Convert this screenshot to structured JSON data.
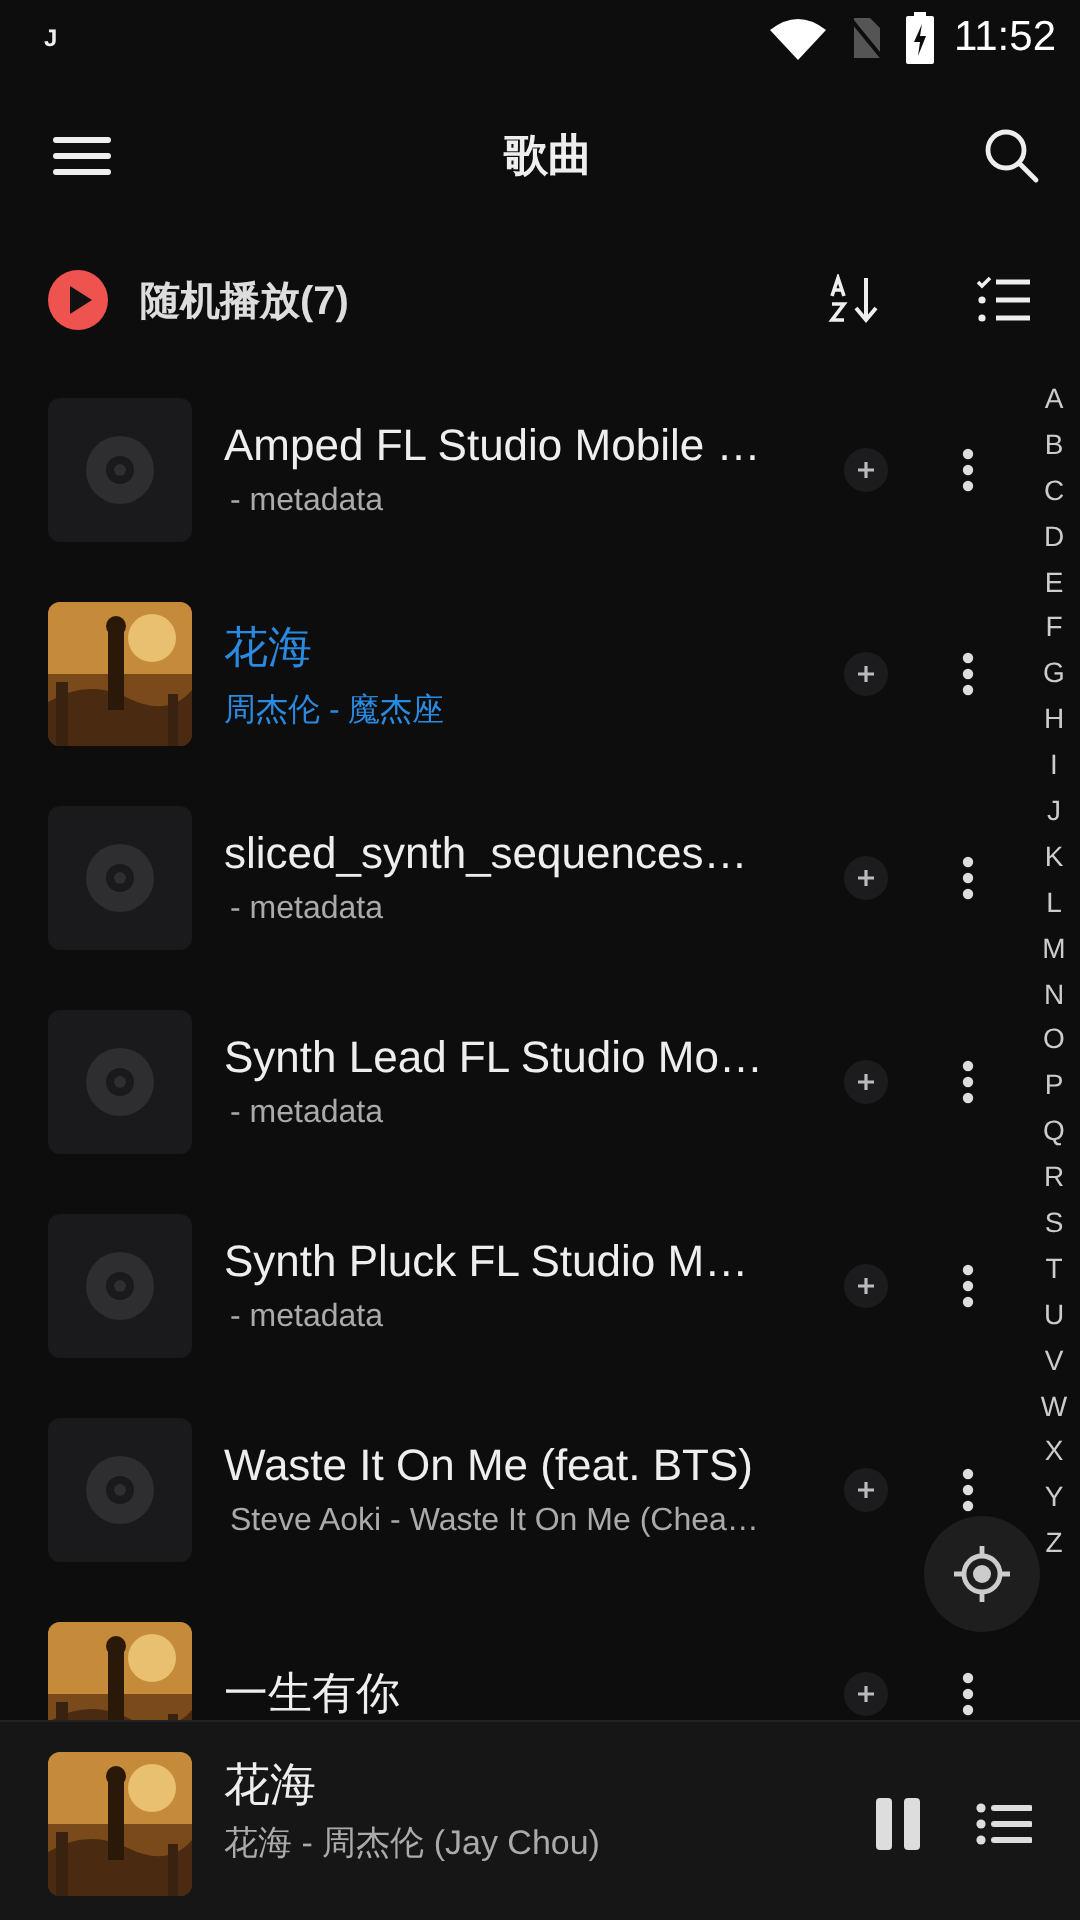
{
  "status_bar": {
    "notification": "J",
    "time": "11:52"
  },
  "toolbar": {
    "title": "歌曲"
  },
  "shuffle": {
    "label": "随机播放(7)"
  },
  "songs": [
    {
      "title": "Amped FL Studio Mobile …",
      "subtitle": "- metadata",
      "kind": "placeholder",
      "selected": false
    },
    {
      "title": "花海",
      "subtitle": "周杰伦 - 魔杰座",
      "kind": "picture",
      "selected": true
    },
    {
      "title": "sliced_synth_sequences…",
      "subtitle": "- metadata",
      "kind": "placeholder",
      "selected": false
    },
    {
      "title": "Synth Lead FL Studio Mo…",
      "subtitle": "- metadata",
      "kind": "placeholder",
      "selected": false
    },
    {
      "title": "Synth Pluck FL Studio M…",
      "subtitle": "- metadata",
      "kind": "placeholder",
      "selected": false
    },
    {
      "title": "Waste It On Me (feat. BTS)",
      "subtitle": "Steve Aoki - Waste It On Me (Chea…",
      "kind": "placeholder",
      "selected": false
    },
    {
      "title": "一生有你",
      "kind": "picture",
      "selected": false
    }
  ],
  "index_letters": [
    "A",
    "B",
    "C",
    "D",
    "E",
    "F",
    "G",
    "H",
    "I",
    "J",
    "K",
    "L",
    "M",
    "N",
    "O",
    "P",
    "Q",
    "R",
    "S",
    "T",
    "U",
    "V",
    "W",
    "X",
    "Y",
    "Z"
  ],
  "player": {
    "title": "花海",
    "subtitle": "花海 - 周杰伦 (Jay Chou)",
    "playing": true
  }
}
